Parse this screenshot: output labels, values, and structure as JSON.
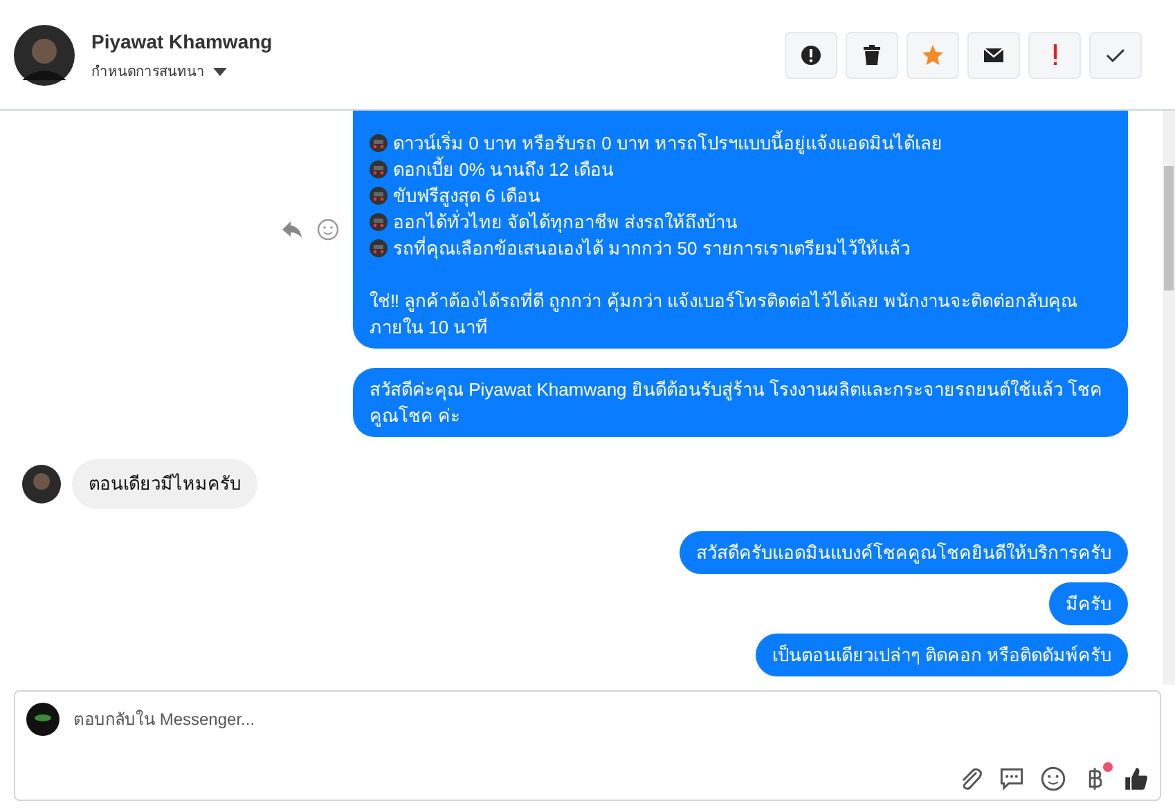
{
  "contact": {
    "name": "Piyawat Khamwang",
    "subtitle": "กำหนดการสนทนา"
  },
  "actions": [
    {
      "kind": "alert"
    },
    {
      "kind": "trash"
    },
    {
      "kind": "star"
    },
    {
      "kind": "mail"
    },
    {
      "kind": "important"
    },
    {
      "kind": "done"
    }
  ],
  "messages": [
    {
      "kind": "outgoing",
      "bullets": [
        "ดาวน์เริ่ม 0 บาท หรือรับรถ 0 บาท หารถโปรฯแบบนี้อยู่แจ้งแอดมินได้เลย",
        "ดอกเบี้ย 0% นานถึง 12 เดือน",
        "ขับฟรีสูงสุด 6 เดือน",
        "ออกได้ทั่วไทย จัดได้ทุกอาชีพ ส่งรถให้ถึงบ้าน",
        "รถที่คุณเลือกข้อเสนอเองได้ มากกว่า 50 รายการเราเตรียมไว้ให้แล้ว"
      ],
      "text": "ใช่‼ ลูกค้าต้องได้รถที่ดี ถูกกว่า คุ้มกว่า แจ้งเบอร์โทรติดต่อไว้ได้เลย พนักงานจะติดต่อกลับคุณภายใน 10 นาที",
      "hover_tools": true
    },
    {
      "kind": "outgoing",
      "text": "สวัสดีค่ะคุณ Piyawat Khamwang ยินดีต้อนรับสู่ร้าน โรงงานผลิตและกระจายรถยนต์ใช้แล้ว โชคคูณโชค ค่ะ"
    },
    {
      "kind": "incoming",
      "text": "ตอนเดียวมีไหมครับ"
    },
    {
      "kind": "outgoing",
      "text": "สวัสดีครับแอดมินแบงค์โชคคูณโชคยินดีให้บริการครับ"
    },
    {
      "kind": "outgoing",
      "text": "มีครับ"
    },
    {
      "kind": "outgoing",
      "text": "เป็นตอนเดียวเปล่าๆ ติดคอก หรือติดดัมพ์ครับ"
    }
  ],
  "composer": {
    "placeholder": "ตอบกลับใน Messenger...",
    "tools": [
      {
        "kind": "attach",
        "badge": false
      },
      {
        "kind": "saved",
        "badge": false
      },
      {
        "kind": "emoji",
        "badge": false
      },
      {
        "kind": "payment",
        "badge": true
      },
      {
        "kind": "like",
        "badge": false
      }
    ]
  }
}
